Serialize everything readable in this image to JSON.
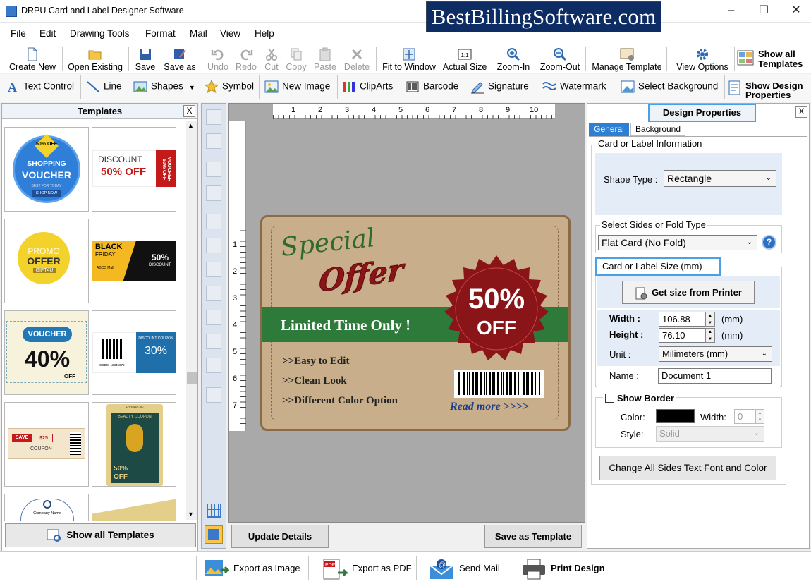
{
  "window": {
    "title": "DRPU Card and Label Designer Software",
    "brand_banner": "BestBillingSoftware.com",
    "controls": [
      "–",
      "☐",
      "✕"
    ]
  },
  "menu": [
    "File",
    "Edit",
    "Drawing Tools",
    "Format",
    "Mail",
    "View",
    "Help"
  ],
  "toolbar1": {
    "create_new": "Create New",
    "open_existing": "Open Existing",
    "save": "Save",
    "save_as": "Save as",
    "undo": "Undo",
    "redo": "Redo",
    "cut": "Cut",
    "copy": "Copy",
    "paste": "Paste",
    "delete": "Delete",
    "fit_to_window": "Fit to Window",
    "actual_size": "Actual Size",
    "zoom_in": "Zoom-In",
    "zoom_out": "Zoom-Out",
    "manage_template": "Manage Template",
    "view_options": "View Options",
    "show_all_templates_1": "Show all",
    "show_all_templates_2": "Templates"
  },
  "toolbar2": {
    "text_control": "Text Control",
    "line": "Line",
    "shapes": "Shapes",
    "symbol": "Symbol",
    "new_image": "New Image",
    "clip_arts": "ClipArts",
    "barcode": "Barcode",
    "signature": "Signature",
    "watermark": "Watermark",
    "select_background": "Select Background",
    "show_design_1": "Show Design",
    "show_design_2": "Properties"
  },
  "templates_panel": {
    "title": "Templates",
    "close": "X",
    "show_all_button": "Show all Templates",
    "thumbs": {
      "t1": {
        "top": "50% OFF",
        "main1": "SHOPPING",
        "main2": "VOUCHER",
        "sub": "BEST FOR TODAY",
        "btn": "SHOP NOW"
      },
      "t2": {
        "l1": "DISCOUNT",
        "l2": "50% OFF",
        "side": "VOUCHER 50% OFF"
      },
      "t3": {
        "l1": "PROMO",
        "l2": "OFFER",
        "l3": "GIFT4U"
      },
      "t4": {
        "l1": "BLACK",
        "l2": "FRIDAY",
        "l3": "50%",
        "l4": "DISCOUNT",
        "l5": "ABCD Mall"
      },
      "t5": {
        "l1": "VOUCHER",
        "l2": "40%",
        "l3": "OFF"
      },
      "t6": {
        "l1": "DISCOUNT COUPON",
        "l2": "30%",
        "l3": "CODE: 12345678"
      },
      "t7": {
        "l1": "SAVE",
        "l2": "$25",
        "l3": "COUPON"
      },
      "t8": {
        "l1": "BEAUTY COUPON",
        "l2": "50%",
        "l3": "OFF",
        "l4": "LARANA Inc"
      },
      "t9": {
        "l1": "Company Name"
      }
    }
  },
  "canvas": {
    "h_ruler": [
      "1",
      "2",
      "3",
      "4",
      "5",
      "6",
      "7",
      "8",
      "9",
      "10"
    ],
    "v_ruler": [
      "1",
      "2",
      "3",
      "4",
      "5",
      "6",
      "7"
    ],
    "card": {
      "special": "Special",
      "offer": "Offer",
      "banner": "Limited Time Only !",
      "badge_pct": "50%",
      "badge_off": "OFF",
      "bullets": [
        ">>Easy to Edit",
        ">>Clean Look",
        ">>Different Color Option"
      ],
      "read_more": "Read more >>>>"
    },
    "update_button": "Update Details",
    "save_template_button": "Save as Template"
  },
  "properties": {
    "title": "Design Properties",
    "close": "X",
    "tabs": [
      "General",
      "Background"
    ],
    "card_info_group": "Card or Label Information",
    "shape_type_label": "Shape Type :",
    "shape_type_value": "Rectangle",
    "sides_group": "Select Sides or Fold Type",
    "sides_value": "Flat Card (No Fold)",
    "size_group": "Card or Label Size (mm)",
    "get_size_button": "Get size from Printer",
    "width_label": "Width :",
    "width_value": "106.88",
    "width_unit": "(mm)",
    "height_label": "Height :",
    "height_value": "76.10",
    "height_unit": "(mm)",
    "unit_label": "Unit :",
    "unit_value": "Milimeters (mm)",
    "name_label": "Name :",
    "name_value": "Document 1",
    "show_border_label": "Show Border",
    "color_label": "Color:",
    "border_width_label": "Width:",
    "border_width_value": "0",
    "style_label": "Style:",
    "style_value": "Solid",
    "change_font_button": "Change All Sides Text Font and Color"
  },
  "bottom": {
    "export_image": "Export as Image",
    "export_pdf": "Export as PDF",
    "send_mail": "Send Mail",
    "print_design": "Print Design"
  },
  "colors": {
    "brand_bg": "#0d2c63",
    "card_bg": "#c8ae8a",
    "banner_green": "#2d7a3a",
    "badge_red": "#8a1518",
    "accent_blue": "#4aa0e6"
  }
}
